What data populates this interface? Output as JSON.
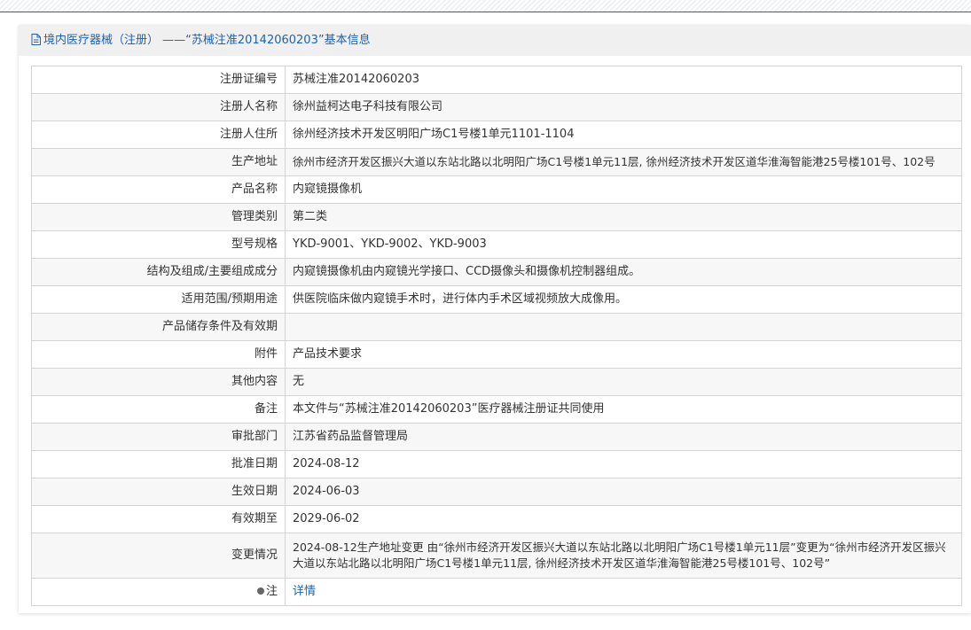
{
  "header": {
    "title": "境内医疗器械（注册） ——“苏械注准20142060203”基本信息"
  },
  "rows": [
    {
      "label": "注册证编号",
      "value": "苏械注准20142060203"
    },
    {
      "label": "注册人名称",
      "value": "徐州益柯达电子科技有限公司"
    },
    {
      "label": "注册人住所",
      "value": "徐州经济技术开发区明阳广场C1号楼1单元1101-1104"
    },
    {
      "label": "生产地址",
      "value": "徐州市经济开发区振兴大道以东站北路以北明阳广场C1号楼1单元11层, 徐州经济技术开发区道华淮海智能港25号楼101号、102号"
    },
    {
      "label": "产品名称",
      "value": "内窥镜摄像机"
    },
    {
      "label": "管理类别",
      "value": "第二类"
    },
    {
      "label": "型号规格",
      "value": "YKD-9001、YKD-9002、YKD-9003"
    },
    {
      "label": "结构及组成/主要组成成分",
      "value": "内窥镜摄像机由内窥镜光学接口、CCD摄像头和摄像机控制器组成。"
    },
    {
      "label": "适用范围/预期用途",
      "value": "供医院临床做内窥镜手术时，进行体内手术区域视频放大成像用。"
    },
    {
      "label": "产品储存条件及有效期",
      "value": ""
    },
    {
      "label": "附件",
      "value": "产品技术要求"
    },
    {
      "label": "其他内容",
      "value": "无"
    },
    {
      "label": "备注",
      "value": "本文件与“苏械注准20142060203”医疗器械注册证共同使用"
    },
    {
      "label": "审批部门",
      "value": "江苏省药品监督管理局"
    },
    {
      "label": "批准日期",
      "value": "2024-08-12"
    },
    {
      "label": "生效日期",
      "value": "2024-06-03"
    },
    {
      "label": "有效期至",
      "value": "2029-06-02"
    },
    {
      "label": "变更情况",
      "value": "2024-08-12生产地址变更 由“徐州市经济开发区振兴大道以东站北路以北明阳广场C1号楼1单元11层”变更为“徐州市经济开发区振兴大道以东站北路以北明阳广场C1号楼1单元11层, 徐州经济技术开发区道华淮海智能港25号楼101号、102号”"
    },
    {
      "label": "注",
      "value": "详情"
    }
  ],
  "colors": {
    "accent": "#1f63a8",
    "header_bg": "#f0f0f0",
    "border": "#d4d4d4",
    "row_alt": "#f7f7f7"
  },
  "icons": {
    "header_icon": "document-icon",
    "note_icon": "lightbulb-icon"
  }
}
